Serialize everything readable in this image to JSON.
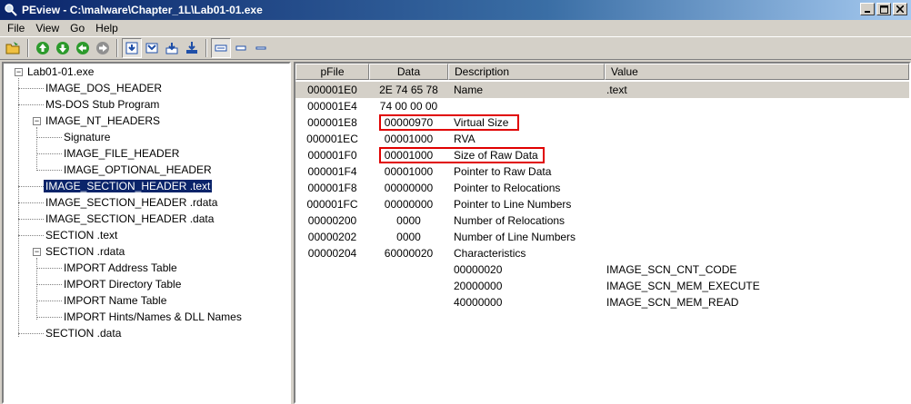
{
  "window": {
    "title": "PEview - C:\\malware\\Chapter_1L\\Lab01-01.exe",
    "title_icon": "magnifier-icon"
  },
  "menu": [
    "File",
    "View",
    "Go",
    "Help"
  ],
  "toolbar": {
    "buttons": [
      "open-file-icon",
      "back-icon",
      "forward-icon",
      "prev-icon",
      "next-icon",
      "view-byte-icon",
      "view-word-icon",
      "view-dword-icon",
      "view-qword-icon",
      "view-details-icon",
      "view-list-icon",
      "view-small-icon"
    ]
  },
  "tree": {
    "root": "Lab01-01.exe",
    "items": [
      "IMAGE_DOS_HEADER",
      "MS-DOS Stub Program",
      "IMAGE_NT_HEADERS",
      "Signature",
      "IMAGE_FILE_HEADER",
      "IMAGE_OPTIONAL_HEADER",
      "IMAGE_SECTION_HEADER .text",
      "IMAGE_SECTION_HEADER .rdata",
      "IMAGE_SECTION_HEADER .data",
      "SECTION .text",
      "SECTION .rdata",
      "IMPORT Address Table",
      "IMPORT Directory Table",
      "IMPORT Name Table",
      "IMPORT Hints/Names & DLL Names",
      "SECTION .data"
    ],
    "selected": "IMAGE_SECTION_HEADER .text"
  },
  "list": {
    "columns": [
      "pFile",
      "Data",
      "Description",
      "Value"
    ],
    "rows": [
      {
        "pfile": "000001E0",
        "data": "2E 74 65 78",
        "desc": "Name",
        "value": ".text"
      },
      {
        "pfile": "000001E4",
        "data": "74 00 00 00",
        "desc": "",
        "value": ""
      },
      {
        "pfile": "000001E8",
        "data": "00000970",
        "desc": "Virtual Size",
        "value": ""
      },
      {
        "pfile": "000001EC",
        "data": "00001000",
        "desc": "RVA",
        "value": ""
      },
      {
        "pfile": "000001F0",
        "data": "00001000",
        "desc": "Size of Raw Data",
        "value": ""
      },
      {
        "pfile": "000001F4",
        "data": "00001000",
        "desc": "Pointer to Raw Data",
        "value": ""
      },
      {
        "pfile": "000001F8",
        "data": "00000000",
        "desc": "Pointer to Relocations",
        "value": ""
      },
      {
        "pfile": "000001FC",
        "data": "00000000",
        "desc": "Pointer to Line Numbers",
        "value": ""
      },
      {
        "pfile": "00000200",
        "data": "0000",
        "desc": "Number of Relocations",
        "value": ""
      },
      {
        "pfile": "00000202",
        "data": "0000",
        "desc": "Number of Line Numbers",
        "value": ""
      },
      {
        "pfile": "00000204",
        "data": "60000020",
        "desc": "Characteristics",
        "value": ""
      },
      {
        "pfile": "",
        "data": "",
        "desc": "00000020",
        "value": "IMAGE_SCN_CNT_CODE"
      },
      {
        "pfile": "",
        "data": "",
        "desc": "20000000",
        "value": "IMAGE_SCN_MEM_EXECUTE"
      },
      {
        "pfile": "",
        "data": "",
        "desc": "40000000",
        "value": "IMAGE_SCN_MEM_READ"
      }
    ],
    "highlight_color": "#e00000",
    "selected_row_color": "#d4d0c8"
  }
}
